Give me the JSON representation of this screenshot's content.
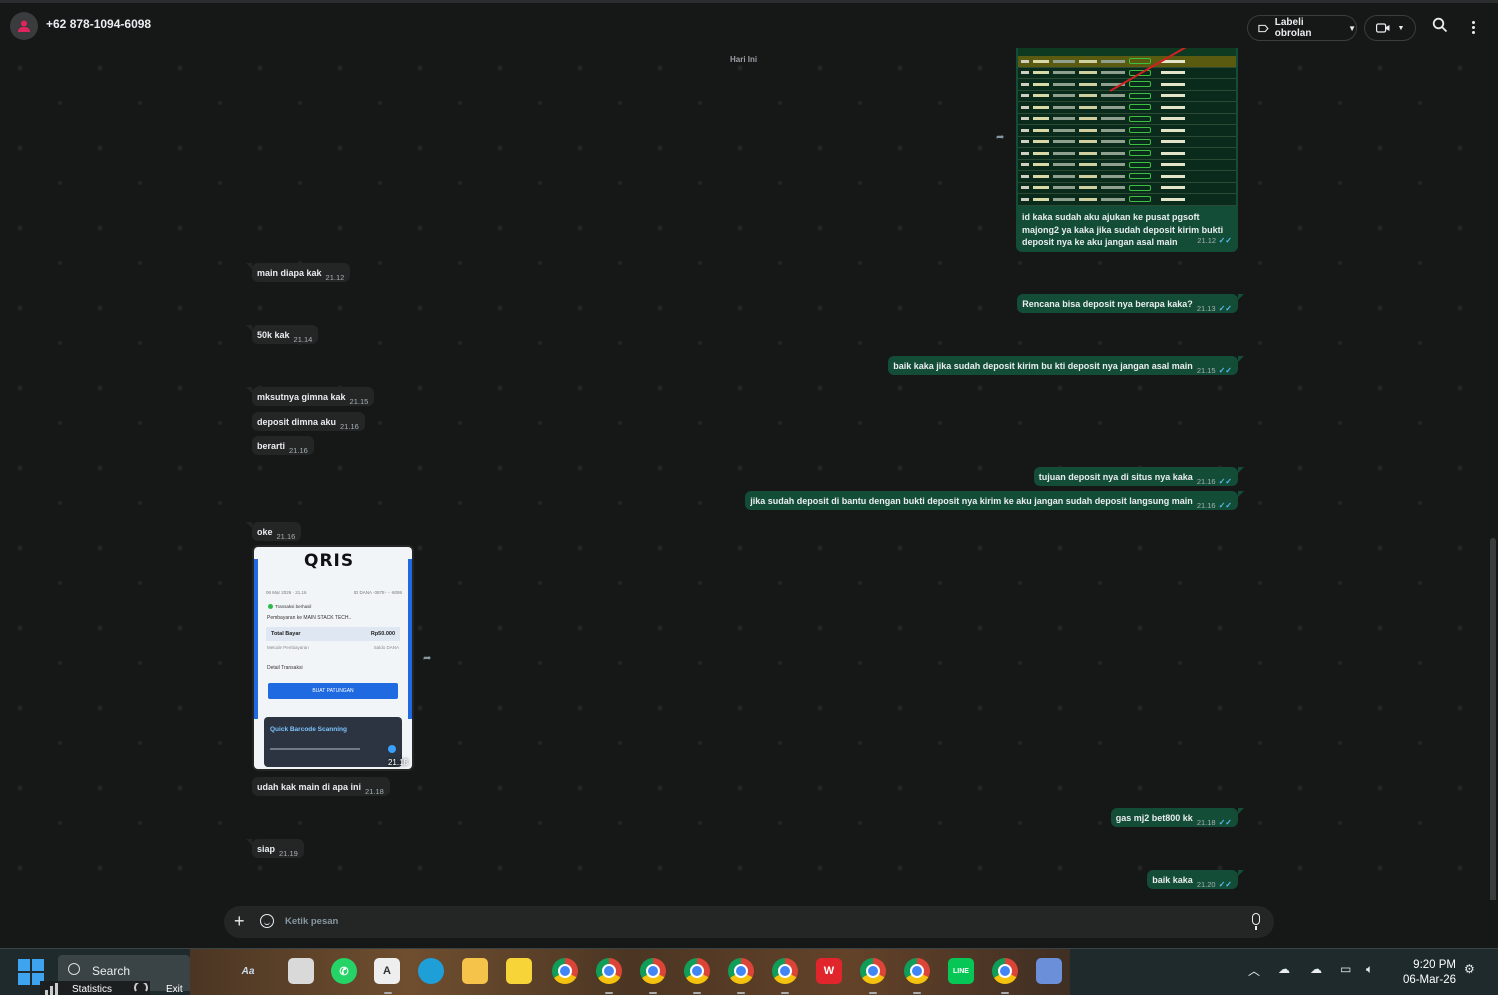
{
  "header": {
    "contact_name": "+62 878-1094-6098",
    "label_button": "Labeli obrolan",
    "icons": [
      "avatar-icon",
      "label-icon",
      "video-call-icon",
      "search-icon",
      "menu-icon"
    ]
  },
  "chat": {
    "day_chip": "Hari Ini",
    "image_message": {
      "caption": "id kaka sudah aku ajukan ke pusat pgsoft majong2 ya kaka jika sudah deposit kirim bukti deposit nya ke aku jangan asal main",
      "time": "21.12"
    },
    "messages": [
      {
        "dir": "in",
        "text": "main diapa kak",
        "time": "21.12"
      },
      {
        "dir": "out",
        "text": "Rencana bisa deposit nya berapa kaka?",
        "time": "21.13"
      },
      {
        "dir": "in",
        "text": "50k kak",
        "time": "21.14"
      },
      {
        "dir": "out",
        "text": "baik kaka  jika sudah deposit kirim bu kti deposit nya jangan asal main",
        "time": "21.15"
      },
      {
        "dir": "in",
        "text": "mksutnya gimna kak",
        "time": "21.15"
      },
      {
        "dir": "in",
        "text": "deposit dimna aku",
        "time": "21.16"
      },
      {
        "dir": "in",
        "text": "berarti",
        "time": "21.16"
      },
      {
        "dir": "out",
        "text": "tujuan deposit nya di situs nya kaka",
        "time": "21.16"
      },
      {
        "dir": "out",
        "text": "jika sudah deposit di bantu dengan bukti deposit nya kirim ke aku jangan sudah deposit langsung main",
        "time": "21.16"
      },
      {
        "dir": "in",
        "text": "oke",
        "time": "21.16"
      },
      {
        "dir": "in",
        "text": "udah kak main di apa ini",
        "time": "21.18"
      },
      {
        "dir": "out",
        "text": "gas mj2 bet800 kk",
        "time": "21.18"
      },
      {
        "dir": "in",
        "text": "siap",
        "time": "21.19"
      },
      {
        "dir": "out",
        "text": "baik kaka",
        "time": "21.20"
      }
    ],
    "qris_image": {
      "logo": "QRIS",
      "meta_left": "06 Mar 2026 · 21.16",
      "meta_right": "ID DANA ·0878·····6098",
      "status": "Transaksi berhasil",
      "payee": "Pembayaran ke MAIN STACK TECH..",
      "total_label": "Total Bayar",
      "total_value": "Rp50.000",
      "method_label": "Metode Pembayaran",
      "method_value": "Saldo DANA",
      "detail_label": "Detail Transaksi",
      "button_label": "BUAT PATUNGAN",
      "ad_title": "Quick Barcode Scanning",
      "time": "21.18"
    }
  },
  "composer": {
    "placeholder": "Ketik pesan"
  },
  "taskbar": {
    "search_label": "Search",
    "stats_label": "Statistics",
    "exit_label": "Exit",
    "clock_time": "9:20 PM",
    "clock_date": "06-Mar-26",
    "accent": "#3ea4f0"
  }
}
